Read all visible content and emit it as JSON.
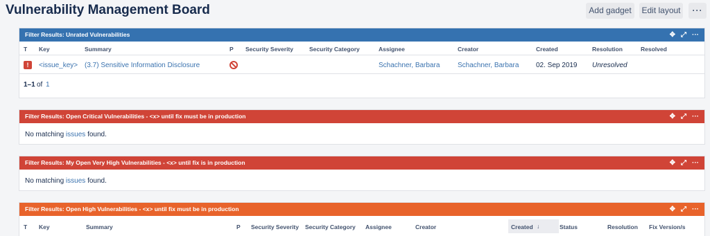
{
  "header": {
    "title": "Vulnerability Management Board",
    "add_gadget_label": "Add gadget",
    "edit_layout_label": "Edit layout",
    "more_label": "···"
  },
  "colors": {
    "blue": "#3572b0",
    "red": "#d04437",
    "orange": "#e8632b"
  },
  "icons": {
    "move": "move-icon",
    "expand": "expand-icon",
    "more": "more-icon"
  },
  "gadgets": [
    {
      "title": "Filter Results: Unrated Vulnerabilities",
      "columns": [
        "T",
        "Key",
        "Summary",
        "P",
        "Security Severity",
        "Security Category",
        "Assignee",
        "Creator",
        "Created",
        "Resolution",
        "Resolved"
      ],
      "rows": [
        {
          "type_icon": "!",
          "key": "<issue_key>",
          "summary": "(3.7) Sensitive Information Disclosure",
          "priority_icon": "blocker-icon",
          "security_severity": "",
          "security_category": "",
          "assignee": "Schachner, Barbara",
          "creator": "Schachner, Barbara",
          "created": "02. Sep 2019",
          "resolution": "Unresolved",
          "resolved": ""
        }
      ],
      "pager": {
        "range": "1–1",
        "of": "of",
        "total": "1"
      }
    },
    {
      "title": "Filter Results: Open Critical Vulnerabilities - <x> until fix must be in production",
      "empty": {
        "prefix": "No matching",
        "link": "issues",
        "suffix": "found."
      }
    },
    {
      "title": "Filter Results: My Open Very High Vulnerabilities - <x> until fix is in production",
      "empty": {
        "prefix": "No matching",
        "link": "issues",
        "suffix": "found."
      }
    },
    {
      "title": "Filter Results: Open High Vulnerabilities - <x> until fix must be in production",
      "columns": [
        "T",
        "Key",
        "Summary",
        "P",
        "Security Severity",
        "Security Category",
        "Assignee",
        "Creator",
        "Created",
        "Status",
        "Resolution",
        "Fix Version/s"
      ],
      "sort_icon": "↓"
    }
  ]
}
